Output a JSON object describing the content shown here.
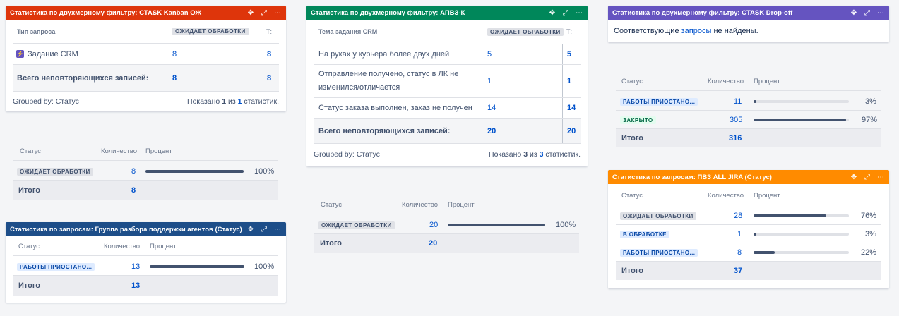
{
  "colors": {
    "red": "#de350b",
    "green": "#00875a",
    "purple": "#6554c0",
    "navy": "#1d4e89",
    "orange": "#ff8b00",
    "bar": "#42526e"
  },
  "icons": {
    "move": "move-icon",
    "expand": "expand-icon",
    "more": "more-icon"
  },
  "g1": {
    "title": "Статистика по двухмерному фильтру: CTASK Kanban ОЖ",
    "col1": "Тип запроса",
    "col2": "ОЖИДАЕТ ОБРАБОТКИ",
    "col3": "Т:",
    "row_label": "Задание CRM",
    "row_val": "8",
    "row_total": "8",
    "total_label": "Всего неповторяющихся записей:",
    "total_val": "8",
    "total_total": "8",
    "grouped": "Grouped by: Статус",
    "shown_pre": "Показано",
    "shown_a": "1",
    "shown_mid": "из",
    "shown_b": "1",
    "shown_post": "статистик."
  },
  "s1": {
    "col_status": "Статус",
    "col_count": "Количество",
    "col_pct": "Процент",
    "rows": [
      {
        "status": "ОЖИДАЕТ ОБРАБОТКИ",
        "count": "8",
        "pct": "100%",
        "fraction": 1.0
      }
    ],
    "total_label": "Итого",
    "total_val": "8"
  },
  "g2": {
    "title": "Статистика по запросам: Группа разбора поддержки агентов (Статус)",
    "col_status": "Статус",
    "col_count": "Количество",
    "col_pct": "Процент",
    "rows": [
      {
        "status": "РАБОТЫ ПРИОСТАНО...",
        "count": "13",
        "pct": "100%",
        "fraction": 1.0
      }
    ],
    "total_label": "Итого",
    "total_val": "13"
  },
  "g3": {
    "title": "Статистика по двухмерному фильтру: АПВЗ-К",
    "col1": "Тема задания CRM",
    "col2": "ОЖИДАЕТ ОБРАБОТКИ",
    "col3": "Т:",
    "rows": [
      {
        "label": "На руках у курьера более двух дней",
        "val": "5",
        "total": "5"
      },
      {
        "label": "Отправление получено, статус в ЛК не изменился/отличается",
        "val": "1",
        "total": "1"
      },
      {
        "label": "Статус заказа выполнен, заказ не получен",
        "val": "14",
        "total": "14"
      }
    ],
    "total_label": "Всего неповторяющихся записей:",
    "total_val": "20",
    "total_total": "20",
    "grouped": "Grouped by: Статус",
    "shown_pre": "Показано",
    "shown_a": "3",
    "shown_mid": "из",
    "shown_b": "3",
    "shown_post": "статистик."
  },
  "s3": {
    "col_status": "Статус",
    "col_count": "Количество",
    "col_pct": "Процент",
    "rows": [
      {
        "status": "ОЖИДАЕТ ОБРАБОТКИ",
        "count": "20",
        "pct": "100%",
        "fraction": 1.0
      }
    ],
    "total_label": "Итого",
    "total_val": "20"
  },
  "g4": {
    "title": "Статистика по двухмерному фильтру: CTASK Drop-off",
    "msg_pre": "Соответствующие",
    "msg_link": "запросы",
    "msg_post": "не найдены."
  },
  "s4": {
    "col_status": "Статус",
    "col_count": "Количество",
    "col_pct": "Процент",
    "rows": [
      {
        "status": "РАБОТЫ ПРИОСТАНО...",
        "count": "11",
        "pct": "3%",
        "fraction": 0.03
      },
      {
        "status": "ЗАКРЫТО",
        "count": "305",
        "pct": "97%",
        "fraction": 0.97
      }
    ],
    "total_label": "Итого",
    "total_val": "316"
  },
  "g5": {
    "title": "Статистика по запросам: ПВЗ ALL JIRA (Статус)",
    "col_status": "Статус",
    "col_count": "Количество",
    "col_pct": "Процент",
    "rows": [
      {
        "status": "ОЖИДАЕТ ОБРАБОТКИ",
        "count": "28",
        "pct": "76%",
        "fraction": 0.76
      },
      {
        "status": "В ОБРАБОТКЕ",
        "count": "1",
        "pct": "3%",
        "fraction": 0.03
      },
      {
        "status": "РАБОТЫ ПРИОСТАНО...",
        "count": "8",
        "pct": "22%",
        "fraction": 0.22
      }
    ],
    "total_label": "Итого",
    "total_val": "37"
  }
}
